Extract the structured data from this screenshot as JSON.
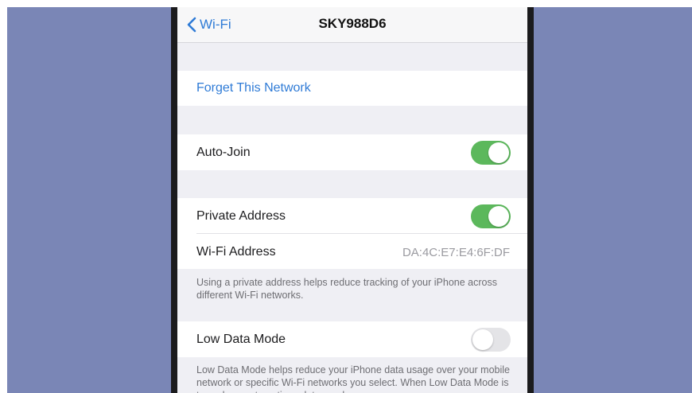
{
  "colors": {
    "background": "#7a86b6",
    "accent": "#2f7bd6",
    "toggle_on": "#5cb85c"
  },
  "navbar": {
    "back_icon": "chevron-left-icon",
    "back_label": "Wi-Fi",
    "title": "SKY988D6"
  },
  "forget": {
    "label": "Forget This Network"
  },
  "auto_join": {
    "label": "Auto-Join",
    "enabled": true
  },
  "private_address": {
    "label": "Private Address",
    "enabled": true
  },
  "wifi_address": {
    "label": "Wi-Fi Address",
    "value": "DA:4C:E7:E4:6F:DF"
  },
  "private_footnote": "Using a private address helps reduce tracking of your iPhone across different Wi-Fi networks.",
  "low_data": {
    "label": "Low Data Mode",
    "enabled": false
  },
  "low_data_footnote": "Low Data Mode helps reduce your iPhone data usage over your mobile network or specific Wi-Fi networks you select. When Low Data Mode is turned on, automatic updates and"
}
